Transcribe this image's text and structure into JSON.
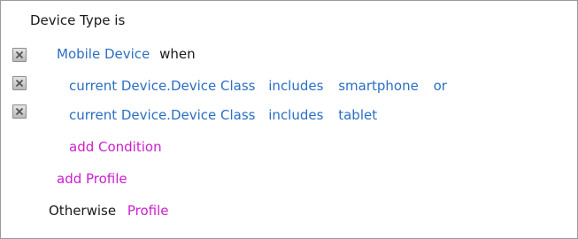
{
  "rule": {
    "header": "Device Type is",
    "case": {
      "profile": "Mobile Device",
      "when": "when",
      "conditions": [
        {
          "subject": "current Device.Device Class",
          "operator": "includes",
          "value": "smartphone",
          "joiner": "or"
        },
        {
          "subject": "current Device.Device Class",
          "operator": "includes",
          "value": "tablet"
        }
      ],
      "add_condition": "add Condition"
    },
    "add_profile": "add Profile",
    "otherwise": {
      "label": "Otherwise",
      "profile": "Profile"
    }
  },
  "icons": {
    "remove": "close-icon"
  },
  "colors": {
    "link_blue": "#2a6fc2",
    "action_magenta": "#cc1fcc",
    "text_dark": "#1a1a1a",
    "border": "#9a9a9a"
  }
}
